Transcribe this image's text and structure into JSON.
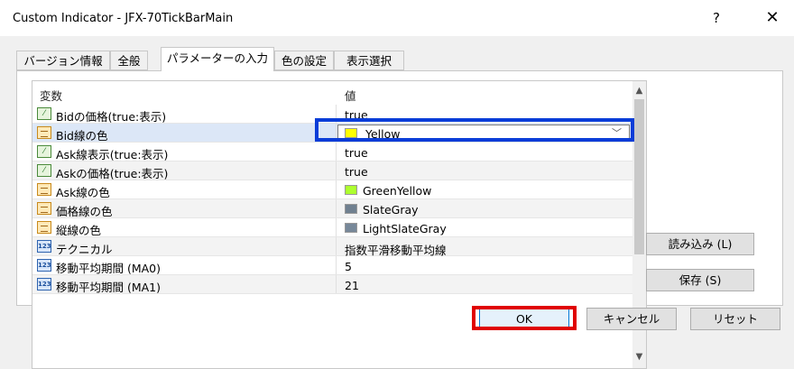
{
  "window": {
    "title": "Custom Indicator - JFX-70TickBarMain",
    "help_label": "?",
    "close_label": "✕"
  },
  "tabs": [
    {
      "label": "バージョン情報",
      "active": false
    },
    {
      "label": "全般",
      "active": false
    },
    {
      "label": "パラメーターの入力",
      "active": true
    },
    {
      "label": "色の設定",
      "active": false
    },
    {
      "label": "表示選択",
      "active": false
    }
  ],
  "grid": {
    "col_variable": "変数",
    "col_value": "値",
    "rows": [
      {
        "icon": "bool-icon",
        "name": "Bidの価格(true:表示)",
        "value": "true"
      },
      {
        "icon": "color-icon",
        "name": "Bid線の色",
        "value": "Yellow",
        "swatch": "#ffff00",
        "editing": true
      },
      {
        "icon": "bool-icon",
        "name": "Ask線表示(true:表示)",
        "value": "true"
      },
      {
        "icon": "bool-icon",
        "name": "Askの価格(true:表示)",
        "value": "true"
      },
      {
        "icon": "color-icon",
        "name": "Ask線の色",
        "value": "GreenYellow",
        "swatch": "#adff2f"
      },
      {
        "icon": "color-icon",
        "name": "価格線の色",
        "value": "SlateGray",
        "swatch": "#708090"
      },
      {
        "icon": "color-icon",
        "name": "縦線の色",
        "value": "LightSlateGray",
        "swatch": "#778899"
      },
      {
        "icon": "num-icon",
        "name": "テクニカル",
        "value": "指数平滑移動平均線"
      },
      {
        "icon": "num-icon",
        "name": "移動平均期間 (MA0)",
        "value": "5"
      },
      {
        "icon": "num-icon",
        "name": "移動平均期間 (MA1)",
        "value": "21"
      }
    ]
  },
  "icons": {
    "bool_glyph": "⁄",
    "num_glyph": "123"
  },
  "buttons": {
    "load": "読み込み (L)",
    "save": "保存 (S)",
    "ok": "OK",
    "cancel": "キャンセル",
    "reset": "リセット"
  },
  "colors": {
    "highlight_blue": "#0a3dd8",
    "highlight_red": "#e00000"
  }
}
